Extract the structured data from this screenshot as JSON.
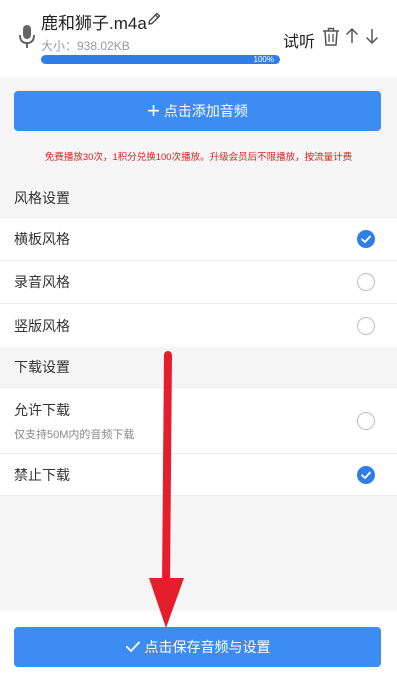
{
  "file": {
    "name": "鹿和狮子.m4a",
    "size_label": "大小：938.02KB",
    "progress_percent": 100,
    "progress_text": "100%",
    "listen_label": "试听"
  },
  "add_audio": {
    "label": "点击添加音频"
  },
  "notice": "免费播放30次，1积分兑换100次播放。升级会员后不限播放，按流量计费",
  "style_section": {
    "title": "风格设置",
    "options": [
      {
        "label": "横板风格",
        "checked": true
      },
      {
        "label": "录音风格",
        "checked": false
      },
      {
        "label": "竖版风格",
        "checked": false
      }
    ]
  },
  "download_section": {
    "title": "下载设置",
    "options": [
      {
        "label": "允许下载",
        "sublabel": "仅支持50M内的音频下载",
        "checked": false
      },
      {
        "label": "禁止下载",
        "checked": true
      }
    ]
  },
  "save_button": {
    "label": "点击保存音频与设置"
  },
  "colors": {
    "accent": "#3d8cf3",
    "notice": "#e02020",
    "annotation_arrow": "#e41f2b"
  },
  "icons": [
    "microphone-icon",
    "edit-pencil-icon",
    "trash-icon",
    "arrow-up-icon",
    "arrow-down-icon",
    "plus-icon",
    "checkmark-icon"
  ]
}
